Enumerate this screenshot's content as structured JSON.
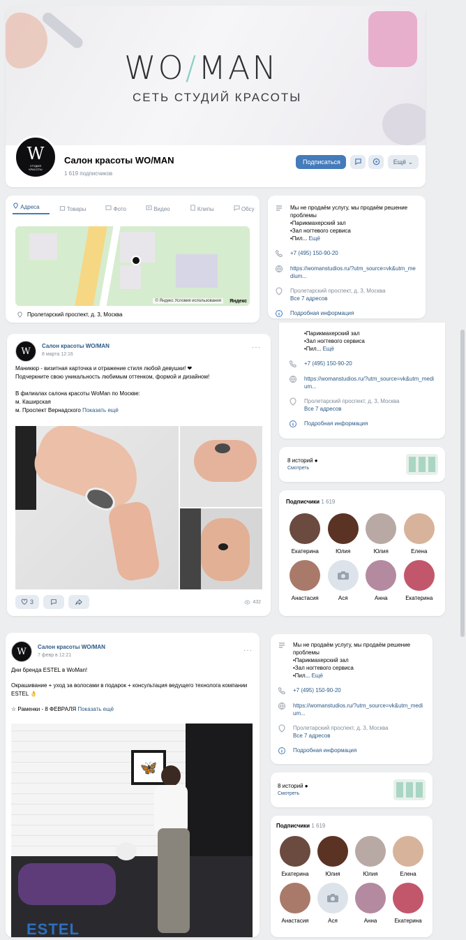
{
  "banner": {
    "brand_left": "WO",
    "brand_slash": "/",
    "brand_right": "MAN",
    "tagline": "СЕТЬ СТУДИЙ КРАСОТЫ"
  },
  "profile": {
    "avatar_big": "W",
    "avatar_sub": "СТУДИЯ\nКРАСОТЫ",
    "name": "Салон красоты WO/MAN",
    "subscribers": "1 619 подписчиков",
    "subscribe_label": "Подписаться",
    "more_label": "Ещё ⌄"
  },
  "tabs": [
    {
      "label": "Адреса"
    },
    {
      "label": "Товары"
    },
    {
      "label": "Фото"
    },
    {
      "label": "Видео"
    },
    {
      "label": "Клипы"
    },
    {
      "label": "Обсу"
    }
  ],
  "map": {
    "attribution": "© Яндекс Условия использования",
    "yandex": "Яндекс",
    "address": "Пролетарский проспект, д. 3, Москва"
  },
  "info1": {
    "desc": "Мы не продаём услугу, мы продаём решение проблемы\n•Парикмахерский зал\n•Зал ногтевого сервиса\n•Пил...",
    "more": "Ещё",
    "phone": "+7 (495) 150-90-20",
    "site": "https://womanstudios.ru/?utm_source=vk&utm_medium...",
    "addr": "Пролетарский проспект, д. 3, Москва",
    "addr_more": "Все 7 адресов",
    "details": "Подробная информация"
  },
  "info2": {
    "desc": "•Парикмахерский зал\n•Зал ногтевого сервиса\n•Пил...",
    "more": "Ещё",
    "phone": "+7 (495) 150-90-20",
    "site": "https://womanstudios.ru/?utm_source=vk&utm_medium...",
    "addr": "Пролетарский проспект, д. 3, Москва",
    "addr_more": "Все 7 адресов",
    "details": "Подробная информация"
  },
  "stories1": {
    "count": "8 историй ●",
    "watch": "Смотреть"
  },
  "subs1": {
    "title": "Подписчики",
    "count": "1 619",
    "people": [
      {
        "name": "Екатерина",
        "color": "#6b4a3f"
      },
      {
        "name": "Юлия",
        "color": "#5a3324"
      },
      {
        "name": "Юлия",
        "color": "#b8a9a4"
      },
      {
        "name": "Елена",
        "color": "#d7b39b"
      },
      {
        "name": "Анастасия",
        "color": "#a97a6a"
      },
      {
        "name": "Ася",
        "color": "#dde3ea"
      },
      {
        "name": "Анна",
        "color": "#b48aa0"
      },
      {
        "name": "Екатерина",
        "color": "#c2576b"
      }
    ]
  },
  "post1": {
    "author": "Салон красоты WO/MAN",
    "date": "8 марта 12:16",
    "line1": "Маникюр - визитная карточка и отражение стиля любой девушки! ❤",
    "line2": "Подчеркните свою уникальность любимым оттенком, формой и дизайном!",
    "line3": "В филиалах салона красоты WoMan по Москве:",
    "line4": "м. Каширская",
    "line5": "м. Проспект Вернадского",
    "show_more": "Показать ещё",
    "likes": "3",
    "views": "432"
  },
  "post2": {
    "author": "Салон красоты WO/MAN",
    "date": "7 февр в 12:21",
    "line1": "Дни бренда ESTEL в WoMan!",
    "line2": "Окрашивание + уход за волосами в подарок + консультация ведущего технолога компании ESTEL 👌",
    "line3": "☆ Раменки - 8 ФЕВРАЛЯ",
    "show_more": "Показать ещё",
    "brand": "ESTEL"
  },
  "info3": {
    "desc": "Мы не продаём услугу, мы продаём решение проблемы\n•Парикмахерский зал\n•Зал ногтевого сервиса\n•Пил...",
    "more": "Ещё",
    "phone": "+7 (495) 150-90-20",
    "site": "https://womanstudios.ru/?utm_source=vk&utm_medium...",
    "addr": "Пролетарский проспект, д. 3, Москва",
    "addr_more": "Все 7 адресов",
    "details": "Подробная информация"
  },
  "stories2": {
    "count": "8 историй ●",
    "watch": "Смотреть"
  },
  "subs2": {
    "title": "Подписчики",
    "count": "1 619",
    "people": [
      {
        "name": "Екатерина",
        "color": "#6b4a3f"
      },
      {
        "name": "Юлия",
        "color": "#5a3324"
      },
      {
        "name": "Юлия",
        "color": "#b8a9a4"
      },
      {
        "name": "Елена",
        "color": "#d7b39b"
      },
      {
        "name": "Анастасия",
        "color": "#a97a6a"
      },
      {
        "name": "Ася",
        "color": "#dde3ea"
      },
      {
        "name": "Анна",
        "color": "#b48aa0"
      },
      {
        "name": "Екатерина",
        "color": "#c2576b"
      }
    ]
  }
}
